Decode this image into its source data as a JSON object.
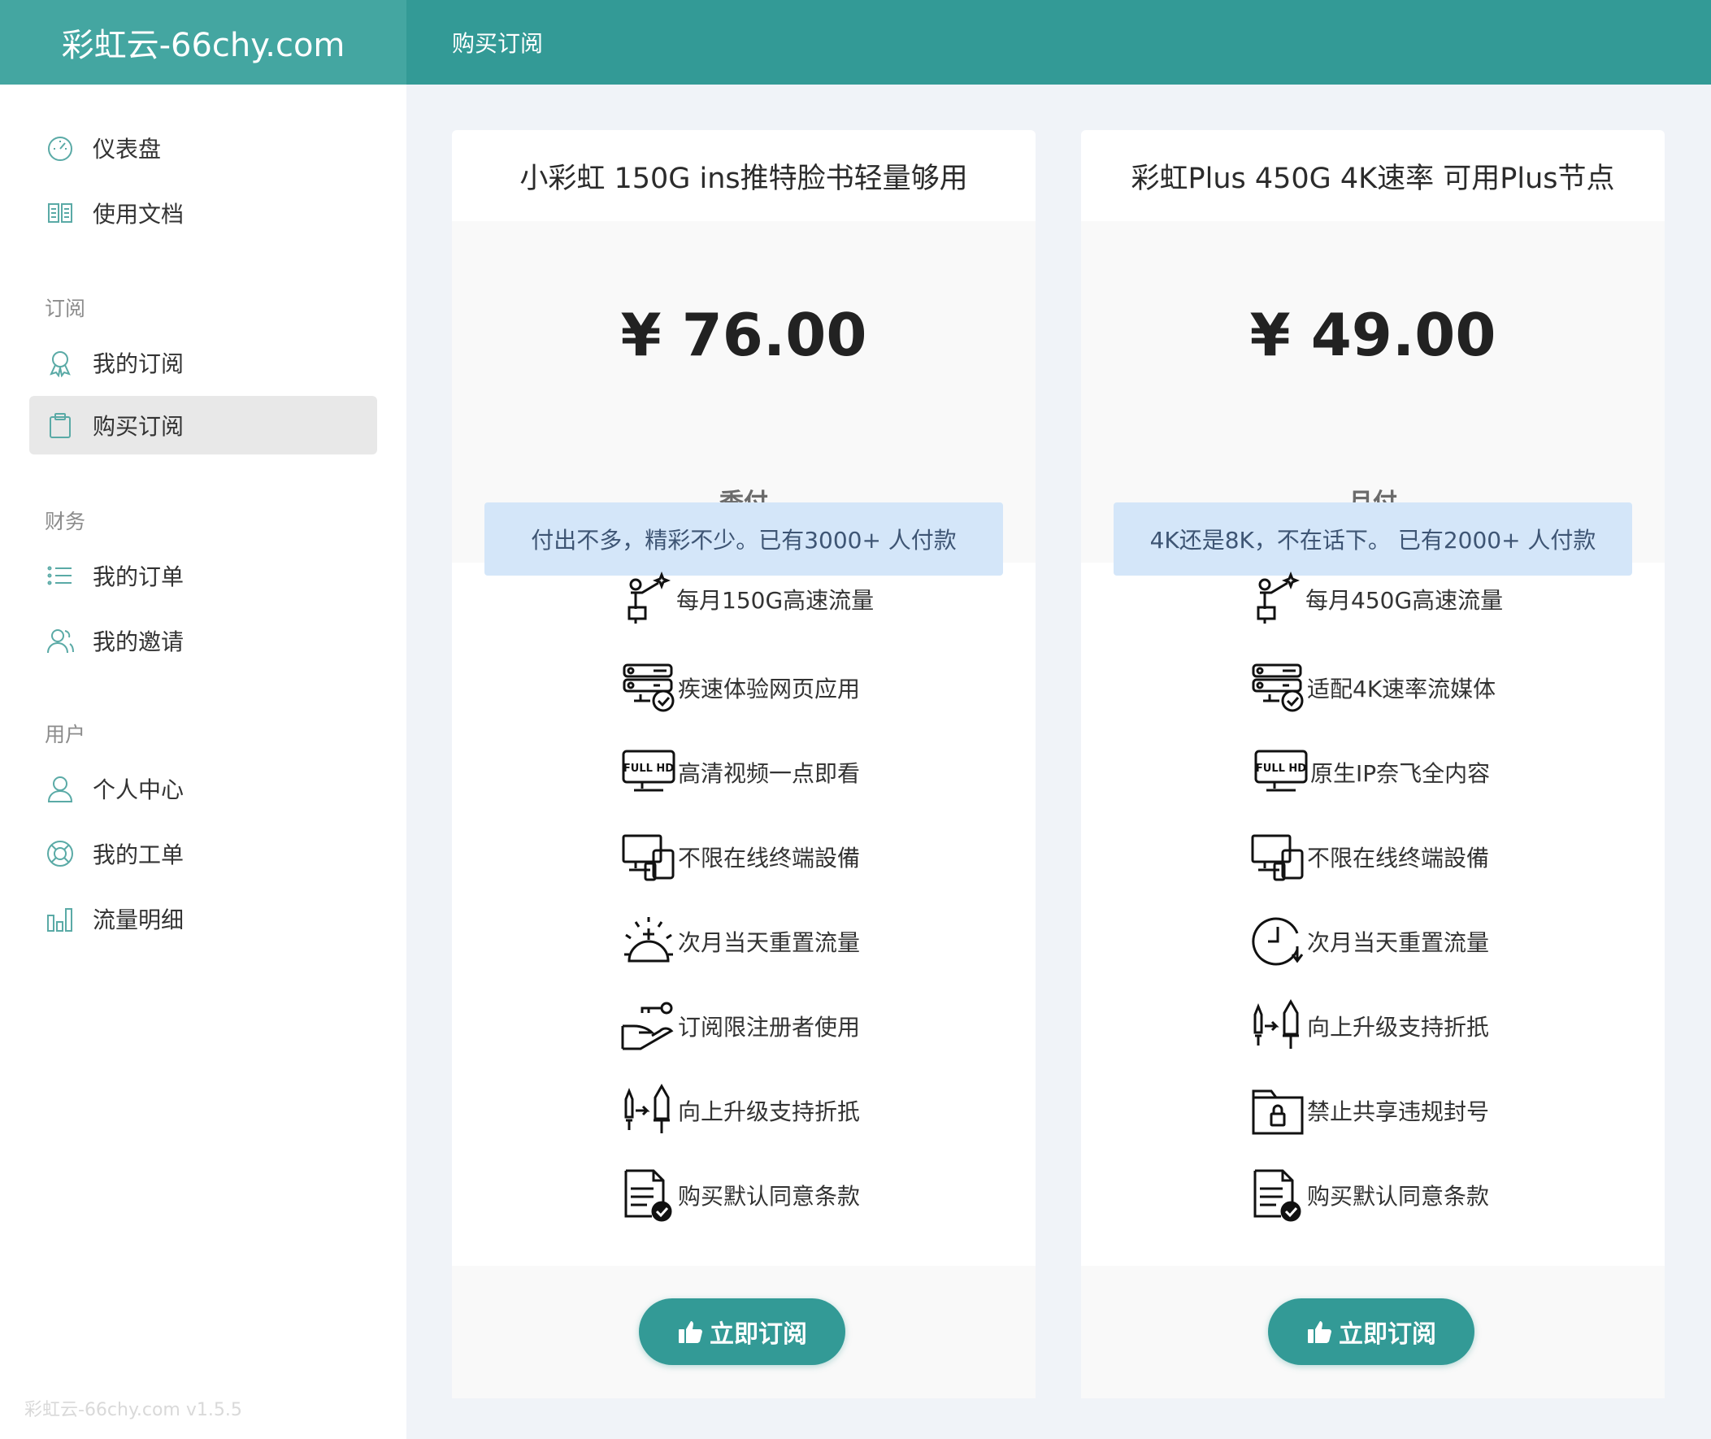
{
  "brand": "彩虹云-66chy.com",
  "header_title": "购买订阅",
  "sidebar": {
    "items": [
      {
        "label": "仪表盘",
        "icon": "dashboard-icon"
      },
      {
        "label": "使用文档",
        "icon": "book-icon"
      },
      {
        "label": "我的订阅",
        "icon": "award-icon"
      },
      {
        "label": "购买订阅",
        "icon": "clipboard-icon",
        "active": true
      },
      {
        "label": "我的订单",
        "icon": "list-icon"
      },
      {
        "label": "我的邀请",
        "icon": "users-icon"
      },
      {
        "label": "个人中心",
        "icon": "user-icon"
      },
      {
        "label": "我的工单",
        "icon": "lifebuoy-icon"
      },
      {
        "label": "流量明细",
        "icon": "bar-chart-icon"
      }
    ],
    "headings": {
      "subscription": "订阅",
      "finance": "财务",
      "user": "用户"
    },
    "footer": "彩虹云-66chy.com v1.5.5"
  },
  "plans": [
    {
      "title": "小彩虹 150G ins推特脸书轻量够用",
      "price": "¥ 76.00",
      "period": "季付",
      "banner": "付出不多，精彩不少。已有3000+ 人付款",
      "features": [
        {
          "text": "每月150G高速流量",
          "icon": "astronomer-icon"
        },
        {
          "text": "疾速体验网页应用",
          "icon": "server-check-icon"
        },
        {
          "text": "高清视频一点即看",
          "icon": "full-hd-monitor-icon"
        },
        {
          "text": "不限在线终端設備",
          "icon": "devices-icon"
        },
        {
          "text": "次月当天重置流量",
          "icon": "sunrise-icon"
        },
        {
          "text": "订阅限注册者使用",
          "icon": "hand-key-icon"
        },
        {
          "text": "向上升级支持折扺",
          "icon": "upgrade-sword-icon"
        },
        {
          "text": "购买默认同意条款",
          "icon": "document-check-icon"
        }
      ],
      "button": "立即订阅"
    },
    {
      "title": "彩虹Plus 450G 4K速率 可用Plus节点",
      "price": "¥ 49.00",
      "period": "月付",
      "banner": "4K还是8K，不在话下。 已有2000+ 人付款",
      "features": [
        {
          "text": "每月450G高速流量",
          "icon": "astronomer-icon"
        },
        {
          "text": "适配4K速率流媒体",
          "icon": "server-check-icon"
        },
        {
          "text": "原生IP奈飞全内容",
          "icon": "full-hd-monitor-icon"
        },
        {
          "text": "不限在线终端設備",
          "icon": "devices-icon"
        },
        {
          "text": "次月当天重置流量",
          "icon": "clock-icon"
        },
        {
          "text": "向上升级支持折扺",
          "icon": "upgrade-sword-icon"
        },
        {
          "text": "禁止共享违规封号",
          "icon": "locked-folder-icon"
        },
        {
          "text": "购买默认同意条款",
          "icon": "document-check-icon"
        }
      ],
      "button": "立即订阅"
    }
  ],
  "colors": {
    "primary": "#339a96",
    "brand_bg": "#44a6a1",
    "banner_bg": "#d4e6f9",
    "page_bg": "#f0f3f8"
  }
}
